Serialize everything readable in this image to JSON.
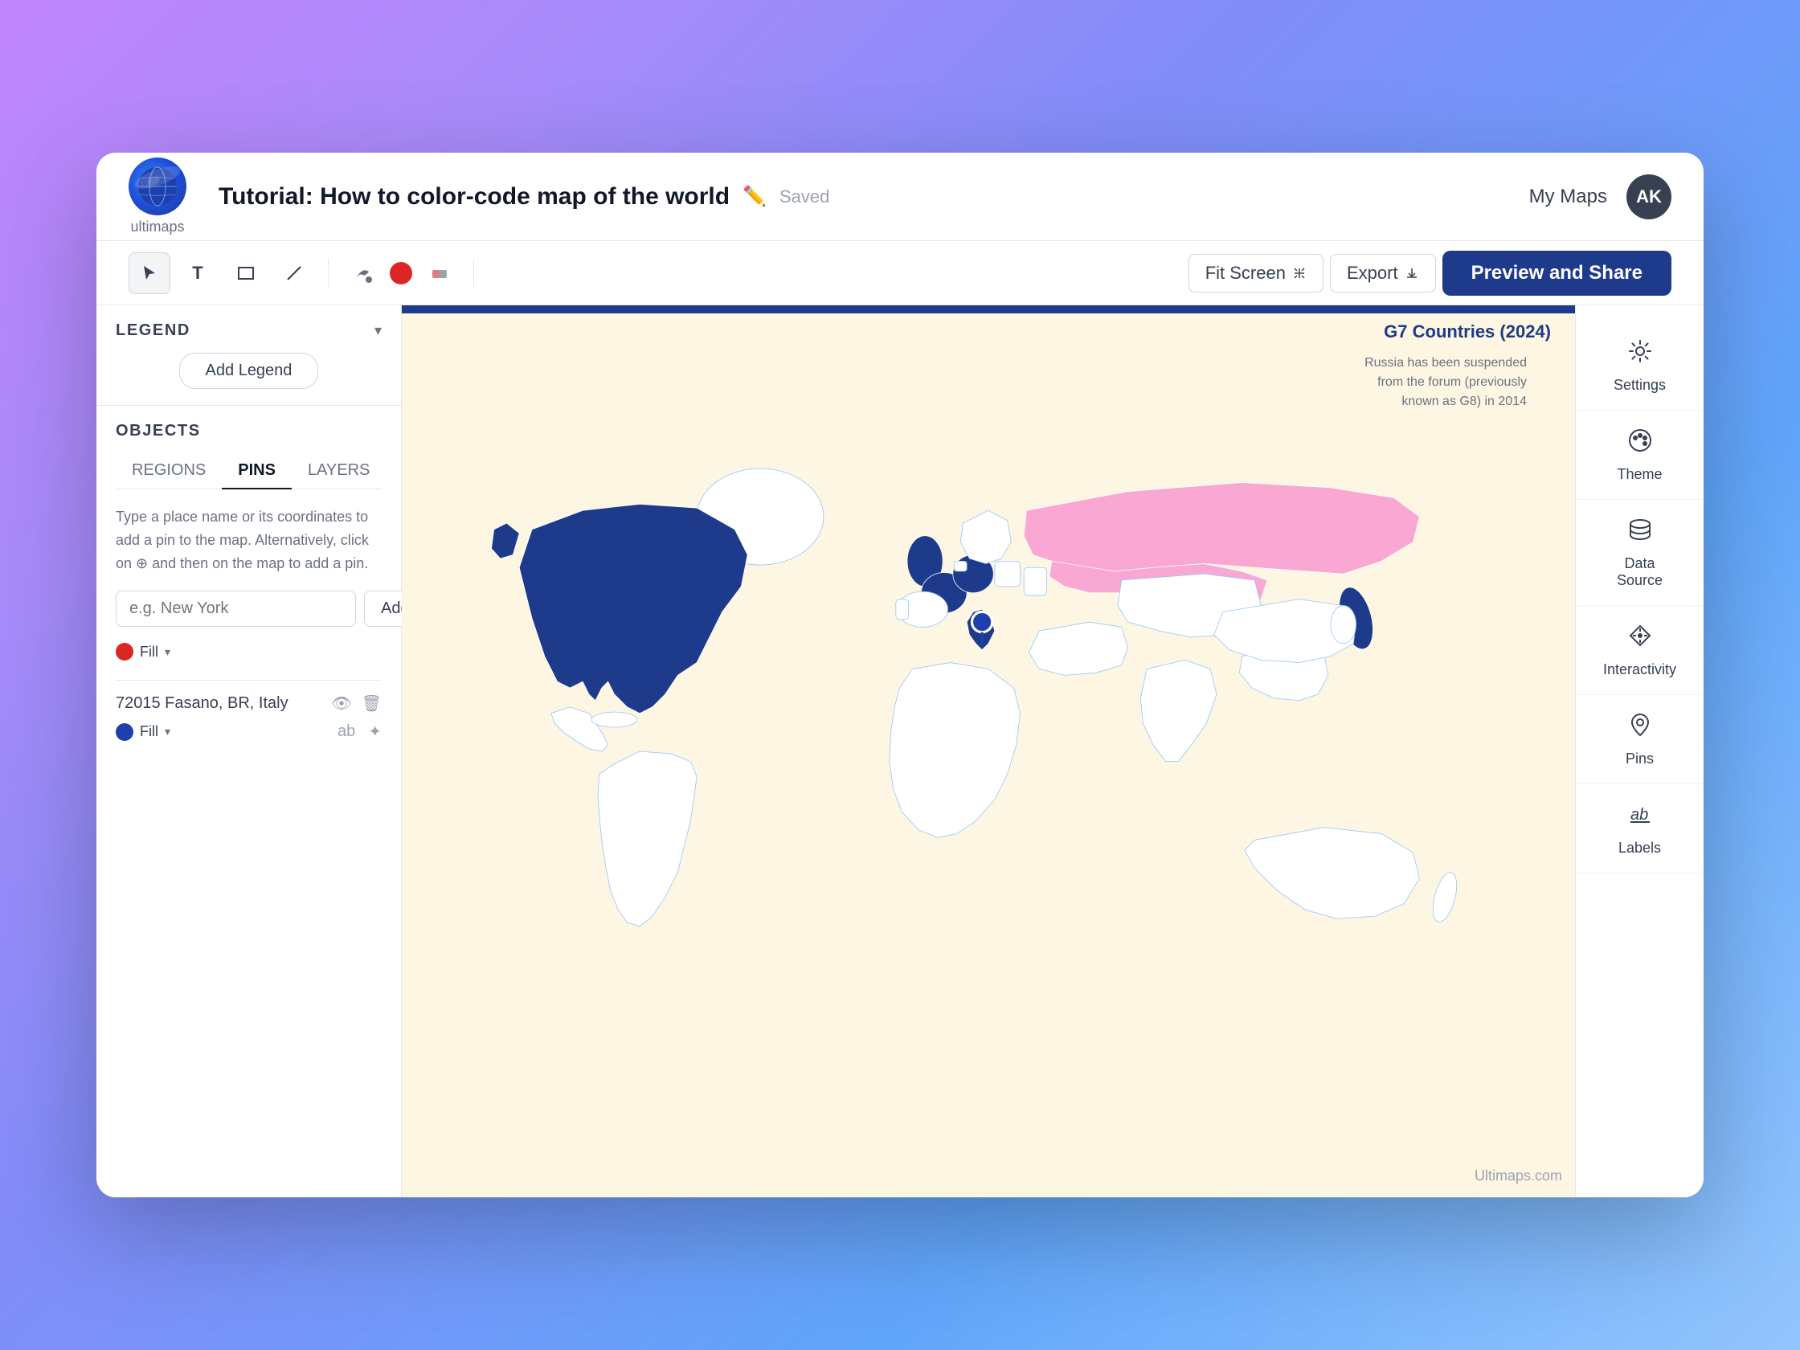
{
  "app": {
    "logo_text": "ultimaps",
    "title": "Tutorial: How to color-code map of the world",
    "saved_label": "Saved",
    "my_maps_label": "My Maps",
    "avatar_initials": "AK"
  },
  "toolbar": {
    "fit_screen_label": "Fit Screen",
    "export_label": "Export",
    "preview_share_label": "Preview and Share"
  },
  "sidebar": {
    "legend_title": "LEGEND",
    "add_legend_label": "Add Legend",
    "objects_title": "OBJECTS",
    "tabs": [
      {
        "label": "REGIONS",
        "active": false
      },
      {
        "label": "PINS",
        "active": true
      },
      {
        "label": "LAYERS",
        "active": false
      }
    ],
    "pins_description": "Type a place name or its coordinates to add a pin to the map. Alternatively, click on  and then on the map to add a pin.",
    "pin_placeholder": "e.g. New York",
    "add_button_label": "Add",
    "fill_label": "Fill",
    "pin_item": {
      "name": "72015 Fasano, BR, Italy",
      "fill_label": "Fill"
    }
  },
  "map": {
    "title": "G7 Countries (2024)",
    "annotation": "Russia has been suspended from the forum (previously known as G8) in 2014"
  },
  "right_panel": {
    "items": [
      {
        "icon": "⚙️",
        "label": "Settings"
      },
      {
        "icon": "🎨",
        "label": "Theme"
      },
      {
        "icon": "🗄️",
        "label": "Data Source"
      },
      {
        "icon": "✨",
        "label": "Interactivity"
      },
      {
        "icon": "📍",
        "label": "Pins"
      },
      {
        "icon": "ab",
        "label": "Labels"
      }
    ]
  },
  "watermark": "Ultimaps.com",
  "colors": {
    "g7": "#1e3a8a",
    "russia": "#f9a8d4",
    "accent": "#1e3a8a",
    "background": "#fdf6e3"
  }
}
